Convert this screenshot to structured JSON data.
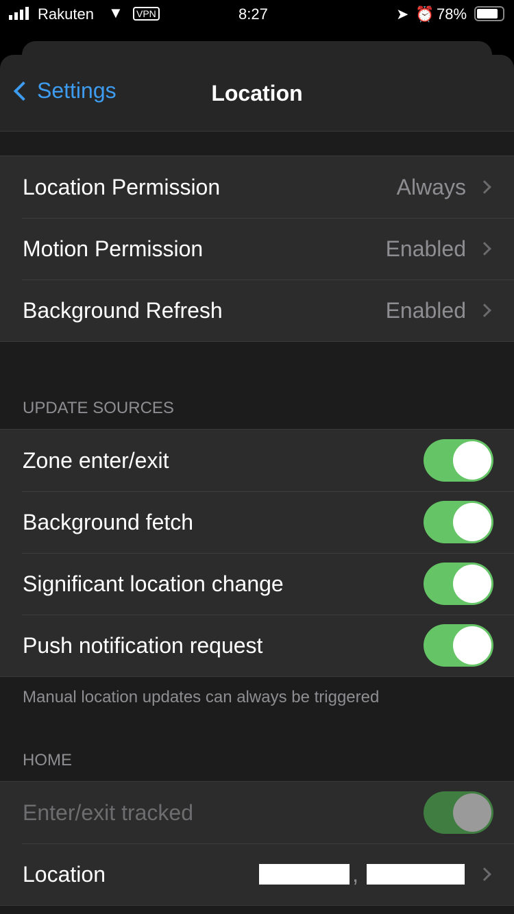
{
  "status_bar": {
    "carrier": "Rakuten",
    "vpn": "VPN",
    "time": "8:27",
    "battery": "78%"
  },
  "nav": {
    "back_label": "Settings",
    "title": "Location"
  },
  "permissions": [
    {
      "label": "Location Permission",
      "value": "Always"
    },
    {
      "label": "Motion Permission",
      "value": "Enabled"
    },
    {
      "label": "Background Refresh",
      "value": "Enabled"
    }
  ],
  "update_sources": {
    "header": "UPDATE SOURCES",
    "footer": "Manual location updates can always be triggered",
    "items": [
      {
        "label": "Zone enter/exit",
        "on": true
      },
      {
        "label": "Background fetch",
        "on": true
      },
      {
        "label": "Significant location change",
        "on": true
      },
      {
        "label": "Push notification request",
        "on": true
      }
    ]
  },
  "home": {
    "header": "HOME",
    "tracked_label": "Enter/exit tracked",
    "tracked_on": true,
    "tracked_disabled": true,
    "location_label": "Location",
    "location_separator": ","
  },
  "colors": {
    "accent": "#3d9cf0",
    "toggle_on": "#65c466"
  }
}
